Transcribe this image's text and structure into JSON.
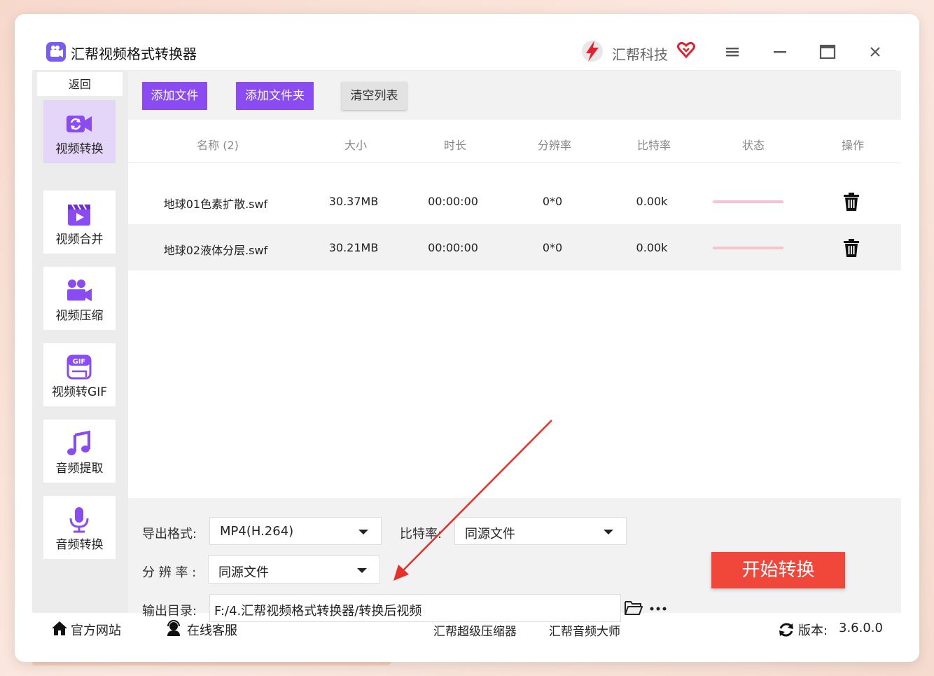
{
  "app": {
    "title": "汇帮视频格式转换器",
    "brand": "汇帮科技"
  },
  "sidebar": {
    "back": "返回",
    "items": [
      {
        "label": "视频转换",
        "icon": "video-convert-icon",
        "active": true
      },
      {
        "label": "视频合并",
        "icon": "video-merge-icon"
      },
      {
        "label": "视频压缩",
        "icon": "video-compress-icon"
      },
      {
        "label": "视频转GIF",
        "icon": "gif-icon"
      },
      {
        "label": "音频提取",
        "icon": "music-note-icon"
      },
      {
        "label": "音频转换",
        "icon": "microphone-icon"
      }
    ]
  },
  "toolbar": {
    "add_file": "添加文件",
    "add_folder": "添加文件夹",
    "clear_list": "清空列表"
  },
  "table": {
    "headers": [
      "名称 (2)",
      "大小",
      "时长",
      "分辨率",
      "比特率",
      "状态",
      "操作"
    ],
    "rows": [
      {
        "name": "地球01色素扩散.swf",
        "size": "30.37MB",
        "duration": "00:00:00",
        "resolution": "0*0",
        "bitrate": "0.00k",
        "progress": 0
      },
      {
        "name": "地球02液体分层.swf",
        "size": "30.21MB",
        "duration": "00:00:00",
        "resolution": "0*0",
        "bitrate": "0.00k",
        "progress": 0
      }
    ]
  },
  "settings": {
    "format_label": "导出格式:",
    "format_value": "MP4(H.264)",
    "bitrate_label": "比特率:",
    "bitrate_value": "同源文件",
    "resolution_label": "分 辨 率 :",
    "resolution_value": "同源文件",
    "output_label": "输出目录:",
    "output_value": "F:/4.汇帮视频格式转换器/转换后视频",
    "start": "开始转换"
  },
  "footer": {
    "website": "官方网站",
    "support": "在线客服",
    "compressor": "汇帮超级压缩器",
    "audio_master": "汇帮音频大师",
    "version_label": "版本:",
    "version": "3.6.0.0"
  },
  "colors": {
    "accent": "#8a4cf2",
    "start": "#f1473a",
    "active_bg": "#e4d6f8",
    "progress": "#f5c4d1"
  }
}
